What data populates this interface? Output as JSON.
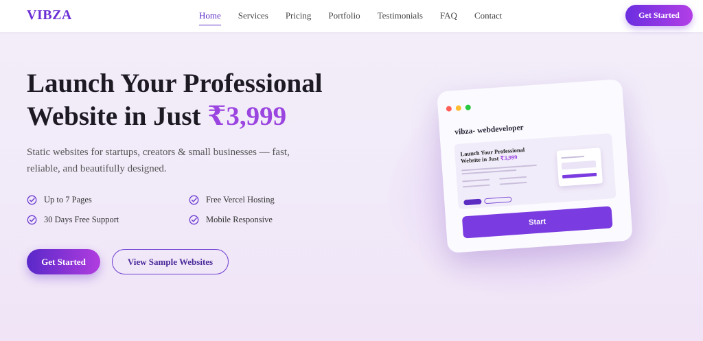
{
  "brand": {
    "logo": "VIBZA"
  },
  "nav": {
    "links": [
      {
        "label": "Home"
      },
      {
        "label": "Services"
      },
      {
        "label": "Pricing"
      },
      {
        "label": "Portfolio"
      },
      {
        "label": "Testimonials"
      },
      {
        "label": "FAQ"
      },
      {
        "label": "Contact"
      }
    ],
    "active": "Home",
    "cta_label": "Get Started"
  },
  "hero": {
    "title_line1": "Launch Your Professional",
    "title_line2_prefix": "Website in Just ",
    "price": "₹3,999",
    "subtitle": "Static websites for startups, creators & small businesses — fast, reliable, and beautifully designed.",
    "features": [
      {
        "label": "Up to 7 Pages"
      },
      {
        "label": "Free Vercel Hosting"
      },
      {
        "label": "30 Days Free Support"
      },
      {
        "label": "Mobile Responsive"
      }
    ],
    "primary_cta": "Get Started",
    "secondary_cta": "View Sample Websites"
  },
  "mockup": {
    "window_title": "vibza- webdeveloper",
    "mini_title_line1": "Launch Your Professional",
    "mini_title_line2_prefix": "Website in Just ",
    "mini_price": "₹3,999",
    "start_label": "Start"
  },
  "colors": {
    "accent": "#6b2fd6",
    "gradient_start": "#5a28c9",
    "gradient_end": "#b13ddf",
    "price": "#9b45e0",
    "dot_red": "#ff5f57",
    "dot_yellow": "#febc2e",
    "dot_green": "#28c840"
  }
}
